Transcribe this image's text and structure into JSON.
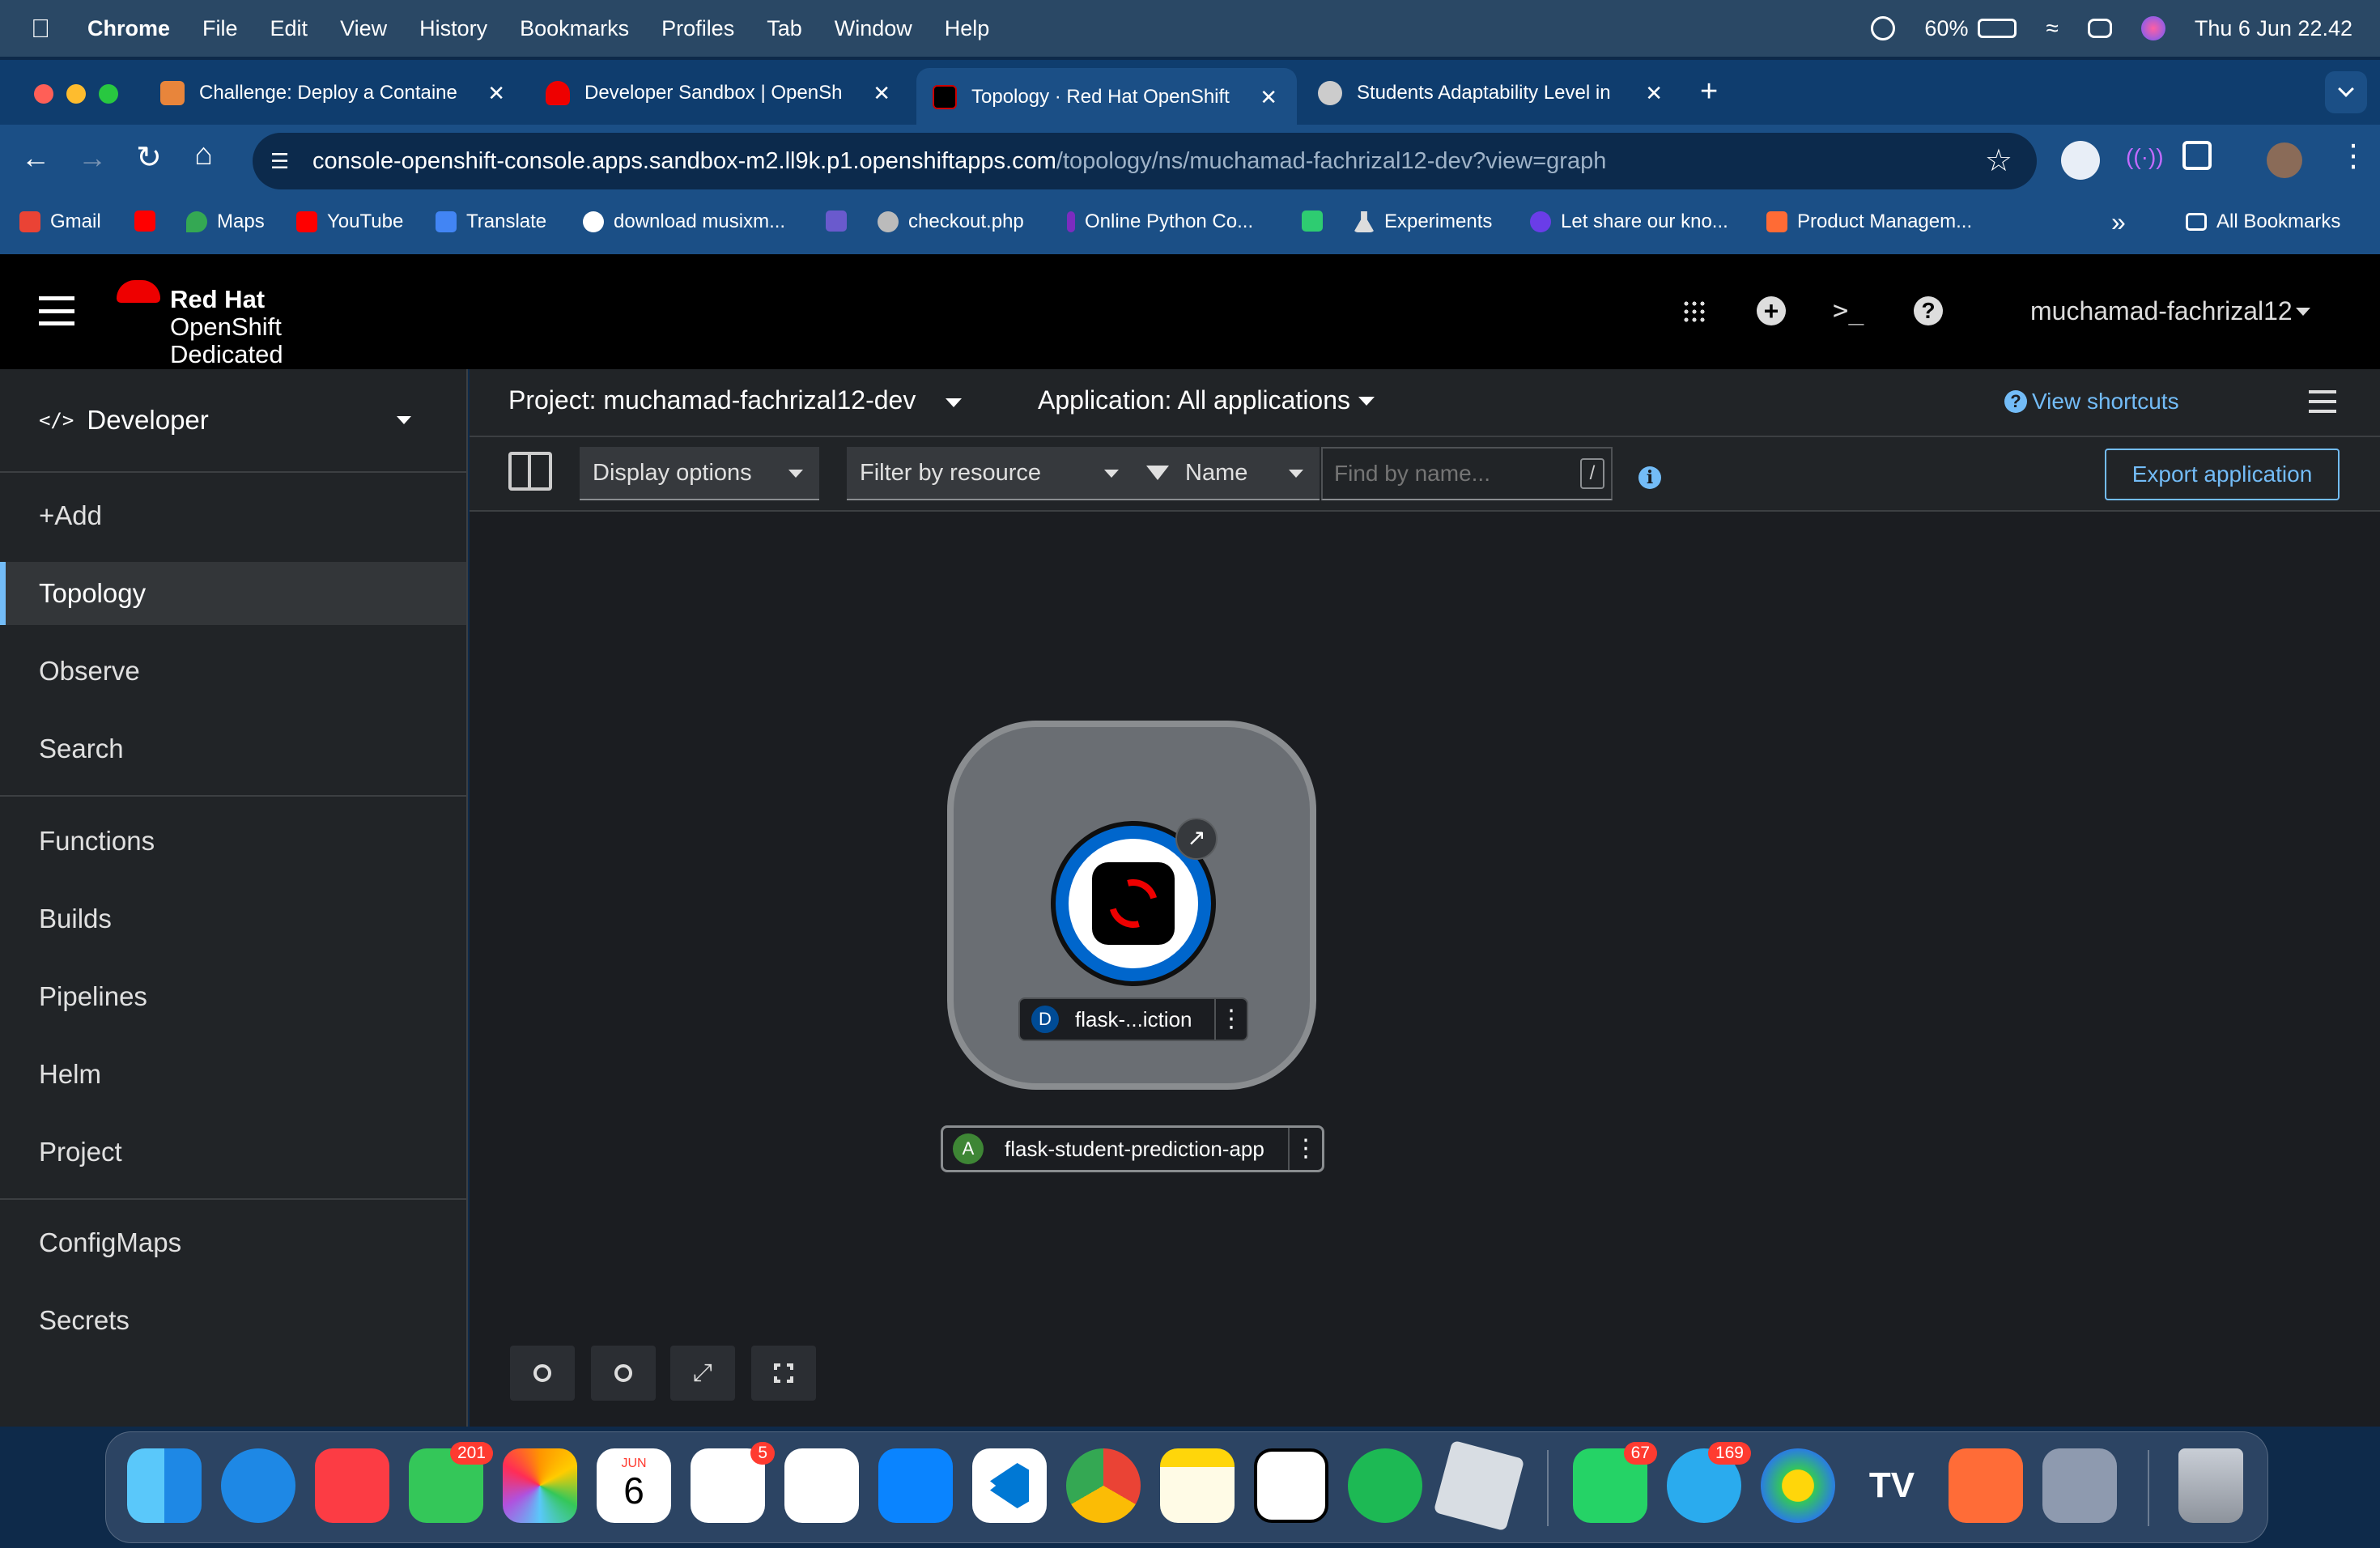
{
  "menubar": {
    "app_name": "Chrome",
    "items": [
      "File",
      "Edit",
      "View",
      "History",
      "Bookmarks",
      "Profiles",
      "Tab",
      "Window",
      "Help"
    ],
    "battery": "60%",
    "clock": "Thu 6 Jun  22.42"
  },
  "tabs": [
    {
      "title": "Challenge: Deploy a Containe",
      "favicon_color": "#e8853b"
    },
    {
      "title": "Developer Sandbox | OpenSh",
      "favicon_color": "#ee0000"
    },
    {
      "title": "Topology · Red Hat OpenShift",
      "favicon_color": "#000000"
    },
    {
      "title": "Students Adaptability Level in",
      "favicon_color": "#cccccc"
    }
  ],
  "new_tab_symbol": "+",
  "address": {
    "host": "console-openshift-console.apps.sandbox-m2.ll9k.p1.openshiftapps.com",
    "path": "/topology/ns/muchamad-fachrizal12-dev?view=graph"
  },
  "bookmarks": [
    {
      "label": "Gmail",
      "color": "#ea4335"
    },
    {
      "label": "",
      "color": "#ff0000"
    },
    {
      "label": "Maps",
      "color": "#34a853"
    },
    {
      "label": "YouTube",
      "color": "#ff0000"
    },
    {
      "label": "Translate",
      "color": "#4285f4"
    },
    {
      "label": "download musixm...",
      "color": "#ffffff"
    },
    {
      "label": "",
      "color": "#6a5acd"
    },
    {
      "label": "checkout.php",
      "color": "#bbbbbb"
    },
    {
      "label": "Online Python Co...",
      "color": "#7b2cbf"
    },
    {
      "label": "",
      "color": "#2ecc71"
    },
    {
      "label": "Experiments",
      "color": "#dddddd"
    },
    {
      "label": "Let share our kno...",
      "color": "#6a3de8"
    },
    {
      "label": "Product Managem...",
      "color": "#ff6b35"
    }
  ],
  "bookmarks_more": "»",
  "all_bookmarks": "All Bookmarks",
  "brand": {
    "line1": "Red Hat",
    "line2": "OpenShift",
    "line3": "Dedicated"
  },
  "user": "muchamad-fachrizal12",
  "perspective": "Developer",
  "nav": [
    "+Add",
    "Topology",
    "Observe",
    "Search",
    "Functions",
    "Builds",
    "Pipelines",
    "Helm",
    "Project",
    "ConfigMaps",
    "Secrets"
  ],
  "active_nav": "Topology",
  "project_label": "Project: muchamad-fachrizal12-dev",
  "application_label": "Application: All applications",
  "view_shortcuts": "View shortcuts",
  "filters": {
    "display_options": "Display options",
    "filter_by_resource": "Filter by resource",
    "name_filter": "Name",
    "find_placeholder": "Find by name...",
    "slash_hint": "/"
  },
  "export_application": "Export application",
  "topology": {
    "deployment_badge": "D",
    "deployment_label": "flask-...iction",
    "app_badge": "A",
    "app_label": "flask-student-prediction-app",
    "ring_color": "#0066cc",
    "app_badge_color": "#3e8635"
  },
  "dock_badges": {
    "messages": "201",
    "reminders": "5",
    "whatsapp": "67",
    "telegram": "169"
  },
  "calendar": {
    "month": "JUN",
    "day": "6"
  }
}
